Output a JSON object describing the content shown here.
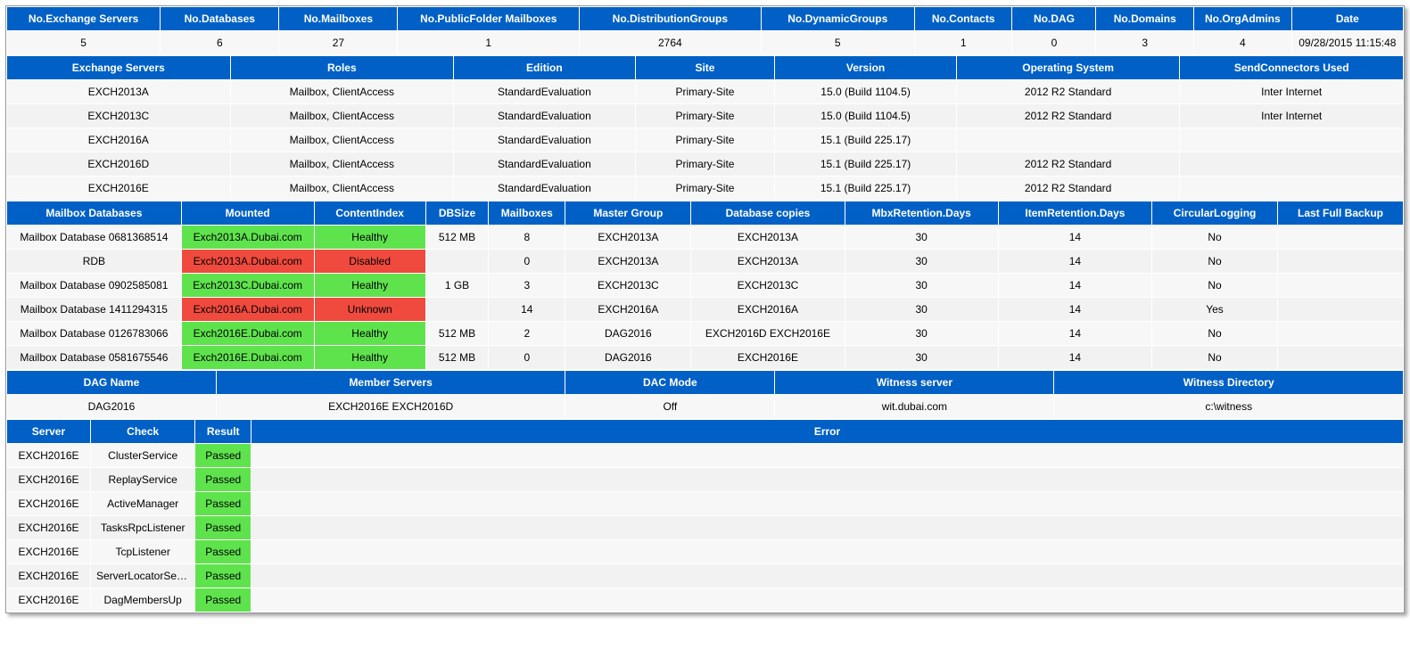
{
  "summary": {
    "headers": [
      "No.Exchange Servers",
      "No.Databases",
      "No.Mailboxes",
      "No.PublicFolder Mailboxes",
      "No.DistributionGroups",
      "No.DynamicGroups",
      "No.Contacts",
      "No.DAG",
      "No.Domains",
      "No.OrgAdmins",
      "Date"
    ],
    "values": [
      "5",
      "6",
      "27",
      "1",
      "2764",
      "5",
      "1",
      "0",
      "3",
      "4",
      "09/28/2015 11:15:48"
    ]
  },
  "servers": {
    "headers": [
      "Exchange Servers",
      "Roles",
      "Edition",
      "Site",
      "Version",
      "Operating System",
      "SendConnectors Used"
    ],
    "rows": [
      [
        "EXCH2013A",
        "Mailbox, ClientAccess",
        "StandardEvaluation",
        "Primary-Site",
        "15.0 (Build 1104.5)",
        "2012 R2 Standard",
        "Inter Internet"
      ],
      [
        "EXCH2013C",
        "Mailbox, ClientAccess",
        "StandardEvaluation",
        "Primary-Site",
        "15.0 (Build 1104.5)",
        "2012 R2 Standard",
        "Inter Internet"
      ],
      [
        "EXCH2016A",
        "Mailbox, ClientAccess",
        "StandardEvaluation",
        "Primary-Site",
        "15.1 (Build 225.17)",
        "",
        ""
      ],
      [
        "EXCH2016D",
        "Mailbox, ClientAccess",
        "StandardEvaluation",
        "Primary-Site",
        "15.1 (Build 225.17)",
        "2012 R2 Standard",
        ""
      ],
      [
        "EXCH2016E",
        "Mailbox, ClientAccess",
        "StandardEvaluation",
        "Primary-Site",
        "15.1 (Build 225.17)",
        "2012 R2 Standard",
        ""
      ]
    ]
  },
  "databases": {
    "headers": [
      "Mailbox Databases",
      "Mounted",
      "ContentIndex",
      "DBSize",
      "Mailboxes",
      "Master Group",
      "Database copies",
      "MbxRetention.Days",
      "ItemRetention.Days",
      "CircularLogging",
      "Last Full Backup"
    ],
    "rows": [
      {
        "db": "Mailbox Database 0681368514",
        "mounted": "Exch2013A.Dubai.com",
        "mstate": "green",
        "ci": "Healthy",
        "cistate": "green",
        "size": "512 MB",
        "mbx": "8",
        "group": "EXCH2013A",
        "copies": "EXCH2013A",
        "mbxret": "30",
        "itemret": "14",
        "circ": "No",
        "backup": ""
      },
      {
        "db": "RDB",
        "mounted": "Exch2013A.Dubai.com",
        "mstate": "red",
        "ci": "Disabled",
        "cistate": "red",
        "size": "",
        "mbx": "0",
        "group": "EXCH2013A",
        "copies": "EXCH2013A",
        "mbxret": "30",
        "itemret": "14",
        "circ": "No",
        "backup": ""
      },
      {
        "db": "Mailbox Database 0902585081",
        "mounted": "Exch2013C.Dubai.com",
        "mstate": "green",
        "ci": "Healthy",
        "cistate": "green",
        "size": "1 GB",
        "mbx": "3",
        "group": "EXCH2013C",
        "copies": "EXCH2013C",
        "mbxret": "30",
        "itemret": "14",
        "circ": "No",
        "backup": ""
      },
      {
        "db": "Mailbox Database 1411294315",
        "mounted": "Exch2016A.Dubai.com",
        "mstate": "red",
        "ci": "Unknown",
        "cistate": "red",
        "size": "",
        "mbx": "14",
        "group": "EXCH2016A",
        "copies": "EXCH2016A",
        "mbxret": "30",
        "itemret": "14",
        "circ": "Yes",
        "backup": ""
      },
      {
        "db": "Mailbox Database 0126783066",
        "mounted": "Exch2016E.Dubai.com",
        "mstate": "green",
        "ci": "Healthy",
        "cistate": "green",
        "size": "512 MB",
        "mbx": "2",
        "group": "DAG2016",
        "copies": "EXCH2016D EXCH2016E",
        "mbxret": "30",
        "itemret": "14",
        "circ": "No",
        "backup": ""
      },
      {
        "db": "Mailbox Database 0581675546",
        "mounted": "Exch2016E.Dubai.com",
        "mstate": "green",
        "ci": "Healthy",
        "cistate": "green",
        "size": "512 MB",
        "mbx": "0",
        "group": "DAG2016",
        "copies": "EXCH2016E",
        "mbxret": "30",
        "itemret": "14",
        "circ": "No",
        "backup": ""
      }
    ]
  },
  "dag": {
    "headers": [
      "DAG Name",
      "Member Servers",
      "DAC Mode",
      "Witness server",
      "Witness Directory"
    ],
    "values": [
      "DAG2016",
      "EXCH2016E EXCH2016D",
      "Off",
      "wit.dubai.com",
      "c:\\witness"
    ]
  },
  "checks": {
    "headers": [
      "Server",
      "Check",
      "Result",
      "Error"
    ],
    "rows": [
      [
        "EXCH2016E",
        "ClusterService",
        "Passed",
        ""
      ],
      [
        "EXCH2016E",
        "ReplayService",
        "Passed",
        ""
      ],
      [
        "EXCH2016E",
        "ActiveManager",
        "Passed",
        ""
      ],
      [
        "EXCH2016E",
        "TasksRpcListener",
        "Passed",
        ""
      ],
      [
        "EXCH2016E",
        "TcpListener",
        "Passed",
        ""
      ],
      [
        "EXCH2016E",
        "ServerLocatorService",
        "Passed",
        ""
      ],
      [
        "EXCH2016E",
        "DagMembersUp",
        "Passed",
        ""
      ]
    ]
  }
}
